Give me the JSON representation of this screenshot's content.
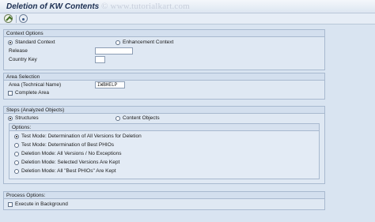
{
  "window": {
    "title": "Deletion of KW Contents",
    "watermark": "© www.tutorialkart.com"
  },
  "toolbar": {
    "icons": [
      "execute-icon",
      "variant-icon"
    ]
  },
  "context_options": {
    "header": "Context Options",
    "standard_label": "Standard Context",
    "enhancement_label": "Enhancement Context",
    "selected": "Standard Context",
    "release_label": "Release",
    "release_value": "",
    "country_label": "Country Key",
    "country_value": ""
  },
  "area_selection": {
    "header": "Area Selection",
    "area_label": "Area (Technical Name)",
    "area_value": "IWBHELP",
    "complete_label": "Complete Area",
    "complete_checked": false
  },
  "steps": {
    "header": "Steps (Analyzed Objects)",
    "structures_label": "Structures",
    "content_label": "Content Objects",
    "selected": "Structures",
    "options": {
      "header": "Options:",
      "items": [
        "Test Mode: Determination of All Versions for Deletion",
        "Test Mode: Determination of Best PHIOs",
        "Deletion Mode: All Versions / No Exceptions",
        "Deletion Mode: Selected Versions Are Kept",
        "Deletion Mode: All \"Best PHIOs\" Are Kept"
      ],
      "selected_index": 0
    }
  },
  "process_options": {
    "header": "Process Options:",
    "background_label": "Execute in Background",
    "background_checked": false
  }
}
